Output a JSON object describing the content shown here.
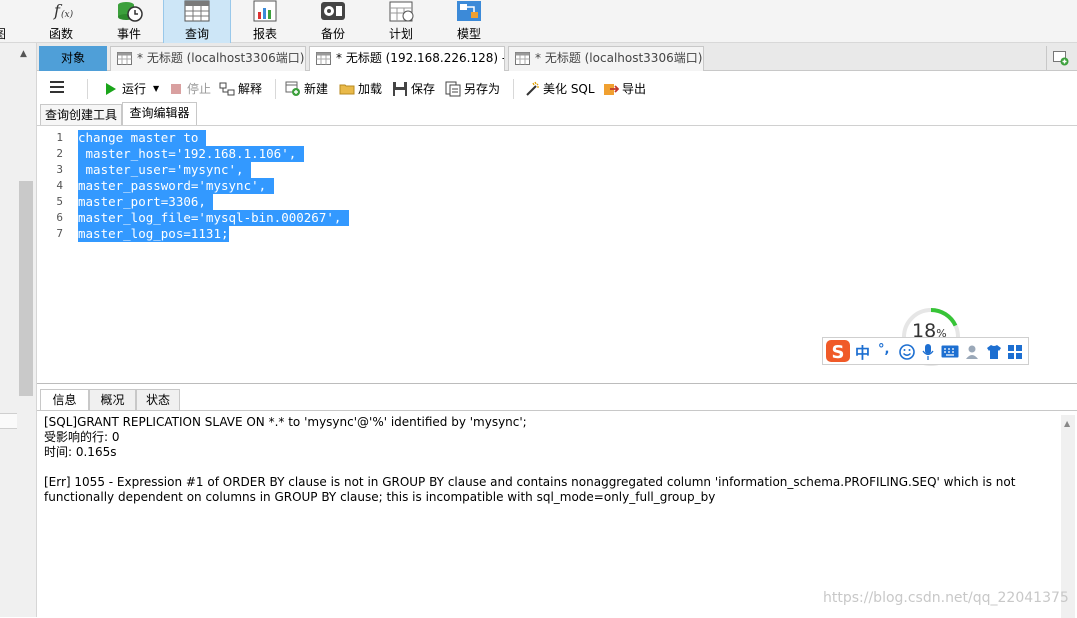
{
  "ribbon": {
    "items": [
      {
        "label": "函数",
        "icon": "function-icon"
      },
      {
        "label": "事件",
        "icon": "event-icon"
      },
      {
        "label": "查询",
        "icon": "query-icon"
      },
      {
        "label": "报表",
        "icon": "report-icon"
      },
      {
        "label": "备份",
        "icon": "backup-icon"
      },
      {
        "label": "计划",
        "icon": "schedule-icon"
      },
      {
        "label": "模型",
        "icon": "model-icon"
      }
    ],
    "partial_label": "图",
    "active": "查询"
  },
  "tabs": {
    "object": "对象",
    "docs": [
      "* 无标题 (localhost3306端口)...",
      "* 无标题 (192.168.226.128) - ...",
      "* 无标题 (localhost3306端口)..."
    ]
  },
  "toolbar": {
    "run": "运行",
    "stop": "停止",
    "explain": "解释",
    "new": "新建",
    "load": "加载",
    "save": "保存",
    "save_as": "另存为",
    "beautify": "美化 SQL",
    "export": "导出"
  },
  "subtabs": [
    "查询创建工具",
    "查询编辑器"
  ],
  "editor": {
    "lines": [
      {
        "num": "1",
        "text": "change master to "
      },
      {
        "num": "2",
        "text": " master_host='192.168.1.106', "
      },
      {
        "num": "3",
        "text": " master_user='mysync', "
      },
      {
        "num": "4",
        "text": "master_password='mysync', "
      },
      {
        "num": "5",
        "text": "master_port=3306, "
      },
      {
        "num": "6",
        "text": "master_log_file='mysql-bin.000267', "
      },
      {
        "num": "7",
        "text": "master_log_pos=1131;"
      }
    ]
  },
  "ime": {
    "gauge_value": "18",
    "gauge_unit": "%",
    "gauge_fraction": 0.18,
    "lang": "中",
    "punct": "°,"
  },
  "bottom": {
    "tabs": [
      "信息",
      "概况",
      "状态"
    ],
    "messages": [
      "[SQL]GRANT REPLICATION SLAVE ON *.* to 'mysync'@'%' identified by 'mysync';",
      "受影响的行: 0",
      "时间: 0.165s",
      "",
      "[Err] 1055 - Expression #1 of ORDER BY clause is not in GROUP BY clause and contains nonaggregated column 'information_schema.PROFILING.SEQ' which is not functionally dependent on columns in GROUP BY clause; this is incompatible with sql_mode=only_full_group_by"
    ]
  },
  "watermark": "https://blog.csdn.net/qq_22041375",
  "colors": {
    "selection": "#3399ff",
    "object_tab": "#4f9fd8",
    "ribbon_active": "#cde6f7",
    "run_green": "#1aa51a",
    "ime_orange": "#f05a28",
    "ime_blue": "#1d6fd1"
  }
}
